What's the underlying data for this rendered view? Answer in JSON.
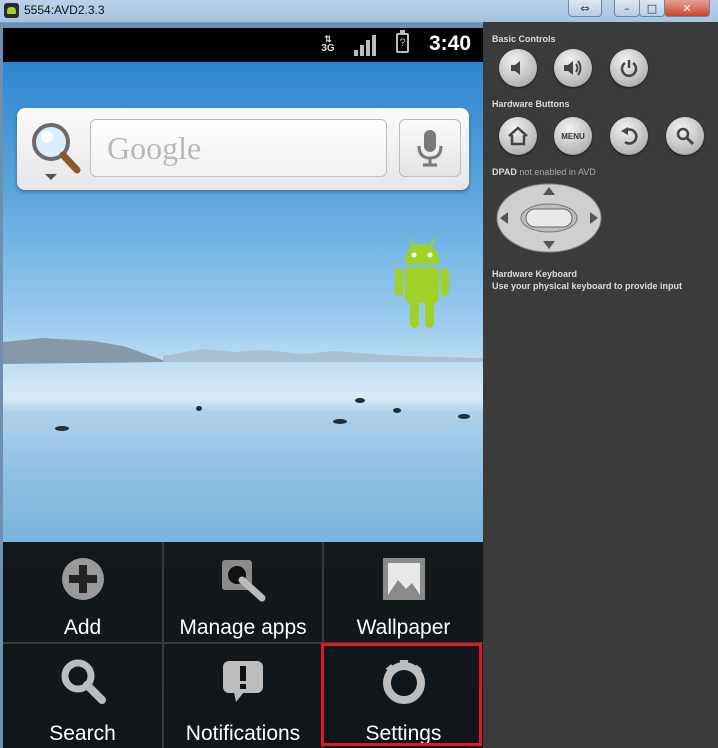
{
  "window": {
    "title": "5554:AVD2.3.3",
    "restore_glyph": "⇔",
    "minimize_glyph": "–",
    "maximize_glyph": "□",
    "close_glyph": "✕"
  },
  "statusbar": {
    "network": "3G",
    "time": "3:40"
  },
  "search_widget": {
    "placeholder": "Google"
  },
  "menu": {
    "items": [
      {
        "label": "Add",
        "icon": "add-icon"
      },
      {
        "label": "Manage apps",
        "icon": "manage-apps-icon"
      },
      {
        "label": "Wallpaper",
        "icon": "wallpaper-icon"
      },
      {
        "label": "Search",
        "icon": "search-icon"
      },
      {
        "label": "Notifications",
        "icon": "notifications-icon"
      },
      {
        "label": "Settings",
        "icon": "settings-icon"
      }
    ],
    "selected": "Settings",
    "highlight_color": "#e3162a"
  },
  "controls": {
    "basic_title": "Basic Controls",
    "hardware_title": "Hardware Buttons",
    "menu_label": "MENU",
    "dpad_title": "DPAD",
    "dpad_note": "not enabled in AVD",
    "keyboard_title": "Hardware Keyboard",
    "keyboard_note": "Use your physical keyboard to provide input"
  },
  "colors": {
    "panel_bg": "#3b3b3b",
    "menu_bg": "#0c0c0c",
    "accent_red": "#e3162a",
    "android_green": "#9fd126"
  }
}
